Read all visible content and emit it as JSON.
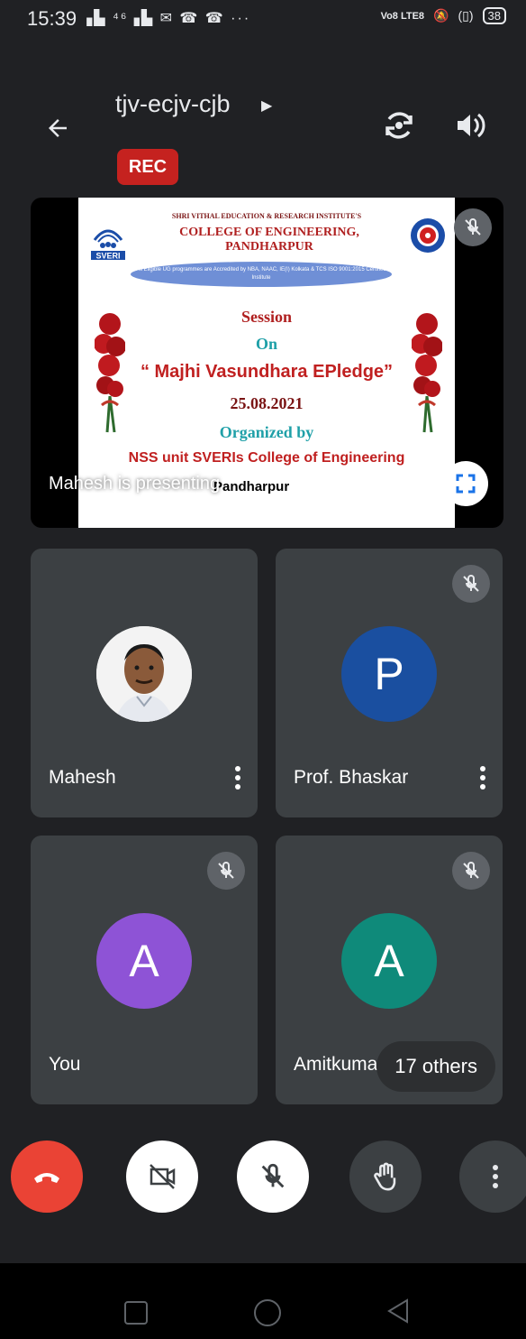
{
  "status_bar": {
    "time": "15:39",
    "left_icons": "▗▙ ⁴⁶▗▙ ✉ ☎ ☎ ···",
    "lte_label": "Vo8 LTE8",
    "battery": "38"
  },
  "header": {
    "meeting_code": "tjv-ecjv-cjb",
    "rec_label": "REC"
  },
  "presentation": {
    "presenter_text": "Mahesh is presenting",
    "slide": {
      "institute_line": "SHRI VITHAL EDUCATION & RESEARCH INSTITUTE'S",
      "college": "COLLEGE OF ENGINEERING, PANDHARPUR",
      "logo_text": "SVERI",
      "accreditation": "All Eligible UG programmes are Accredited by NBA, NAAC, IE(I) Kolkata & TCS ISO 9001:2015 Certified Institute",
      "session": "Session",
      "on": "On",
      "title": "“ Majhi Vasundhara EPledge”",
      "date": "25.08.2021",
      "organized": "Organized by",
      "unit": "NSS unit SVERIs College of Engineering",
      "place": "Pandharpur"
    }
  },
  "participants": [
    {
      "name": "Mahesh",
      "initial": "",
      "color": "#ffffff"
    },
    {
      "name": "Prof. Bhaskar",
      "initial": "P",
      "color": "#1a4fa0"
    },
    {
      "name": "You",
      "initial": "A",
      "color": "#8e53d6"
    },
    {
      "name": "Amitkumar",
      "initial": "A",
      "color": "#0f8a7a"
    }
  ],
  "others_label": "17 others",
  "colors": {
    "background": "#202124",
    "tile": "#3c4043",
    "end_call": "#ea4335",
    "rec": "#c5221f"
  }
}
